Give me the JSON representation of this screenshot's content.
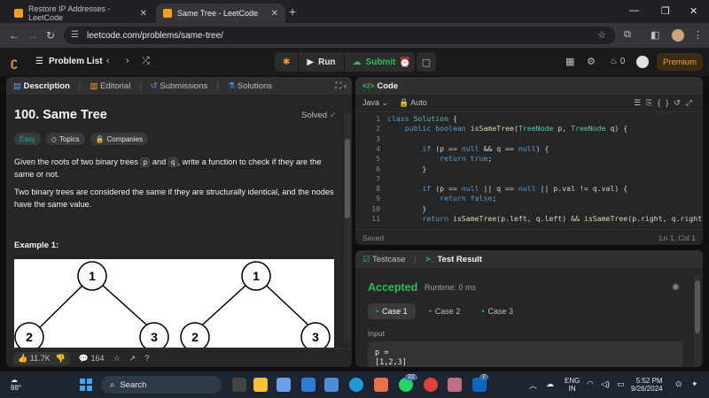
{
  "browser": {
    "tabs": [
      {
        "title": "Restore IP Addresses - LeetCode",
        "active": false
      },
      {
        "title": "Same Tree - LeetCode",
        "active": true
      }
    ],
    "url": "leetcode.com/problems/same-tree/"
  },
  "header": {
    "problem_list": "Problem List",
    "run": "Run",
    "submit": "Submit",
    "streak": "0",
    "premium": "Premium"
  },
  "left_panel": {
    "tabs": [
      "Description",
      "Editorial",
      "Submissions",
      "Solutions"
    ],
    "title": "100. Same Tree",
    "status": "Solved",
    "tags": [
      "Easy",
      "Topics",
      "Companies"
    ],
    "desc1_a": "Given the roots of two binary trees ",
    "desc1_p": "p",
    "desc1_and": " and ",
    "desc1_q": "q",
    "desc1_b": ", write a function to check if they are the same or not.",
    "desc2": "Two binary trees are considered the same if they are structurally identical, and the nodes have the same value.",
    "example_label": "Example 1:",
    "tree_nodes": [
      "1",
      "2",
      "3",
      "1",
      "2",
      "3"
    ],
    "likes": "11.7K",
    "comments": "164"
  },
  "code_panel": {
    "title": "Code",
    "language": "Java",
    "mode": "Auto",
    "lines": [
      {
        "n": "1",
        "code": "class Solution {"
      },
      {
        "n": "2",
        "code": "    public boolean isSameTree(TreeNode p, TreeNode q) {"
      },
      {
        "n": "3",
        "code": ""
      },
      {
        "n": "4",
        "code": "        if (p == null && q == null) {"
      },
      {
        "n": "5",
        "code": "            return true;"
      },
      {
        "n": "6",
        "code": "        }"
      },
      {
        "n": "7",
        "code": ""
      },
      {
        "n": "8",
        "code": "        if (p == null || q == null || p.val != q.val) {"
      },
      {
        "n": "9",
        "code": "            return false;"
      },
      {
        "n": "10",
        "code": "        }"
      },
      {
        "n": "11",
        "code": "        return isSameTree(p.left, q.left) && isSameTree(p.right, q.right);"
      }
    ],
    "saved": "Saved",
    "cursor": "Ln 1, Col 1"
  },
  "test_panel": {
    "tabs": [
      "Testcase",
      "Test Result"
    ],
    "result": "Accepted",
    "runtime": "Runtime: 0 ms",
    "cases": [
      "Case 1",
      "Case 2",
      "Case 3"
    ],
    "input_label": "Input",
    "input_line1": "p =",
    "input_line2": "[1,2,3]"
  },
  "taskbar": {
    "temp": "88°",
    "search": "Search",
    "badge1": "22",
    "badge2": "7",
    "lang1": "ENG",
    "lang2": "IN",
    "time": "5:52 PM",
    "date": "9/26/2024"
  },
  "colors": {
    "accent": "#ffa116",
    "success": "#2cbb5d",
    "easy": "#00b8a3"
  }
}
